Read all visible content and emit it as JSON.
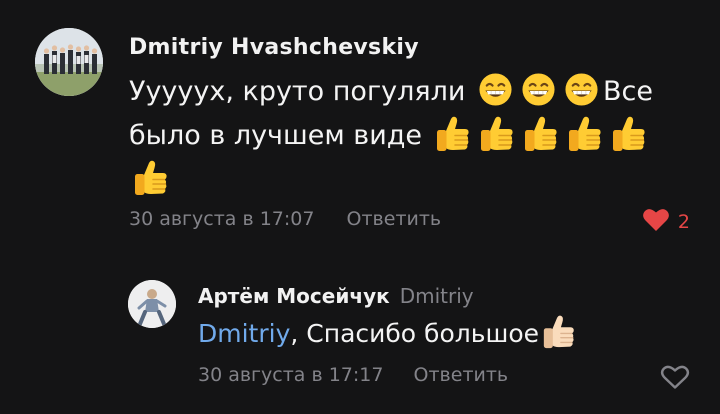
{
  "comments": [
    {
      "author": "Dmitriy Hvashchevskiy",
      "text_part1": "Уууууx, круто погуляли",
      "text_part2": "Все было в лучшем виде",
      "emoji_after_part1": [
        "grinning-face",
        "grinning-face",
        "grinning-face"
      ],
      "emoji_after_part2": [
        "thumbs-up",
        "thumbs-up",
        "thumbs-up",
        "thumbs-up",
        "thumbs-up",
        "thumbs-up"
      ],
      "date": "30 августа в 17:07",
      "reply_label": "Ответить",
      "likes": "2",
      "liked": true
    },
    {
      "author": "Артём Мосейчук",
      "reply_to": "Dmitriy",
      "mention": "Dmitriy",
      "text": ", Спасибо большое",
      "emoji_after_text": [
        "thumbs-up-light-skin"
      ],
      "date": "30 августа в 17:17",
      "reply_label": "Ответить",
      "liked": false
    }
  ],
  "colors": {
    "background": "#141415",
    "text": "#f4f4f4",
    "secondary_text": "#838389",
    "like_active": "#e64646",
    "mention": "#71aaeb"
  }
}
